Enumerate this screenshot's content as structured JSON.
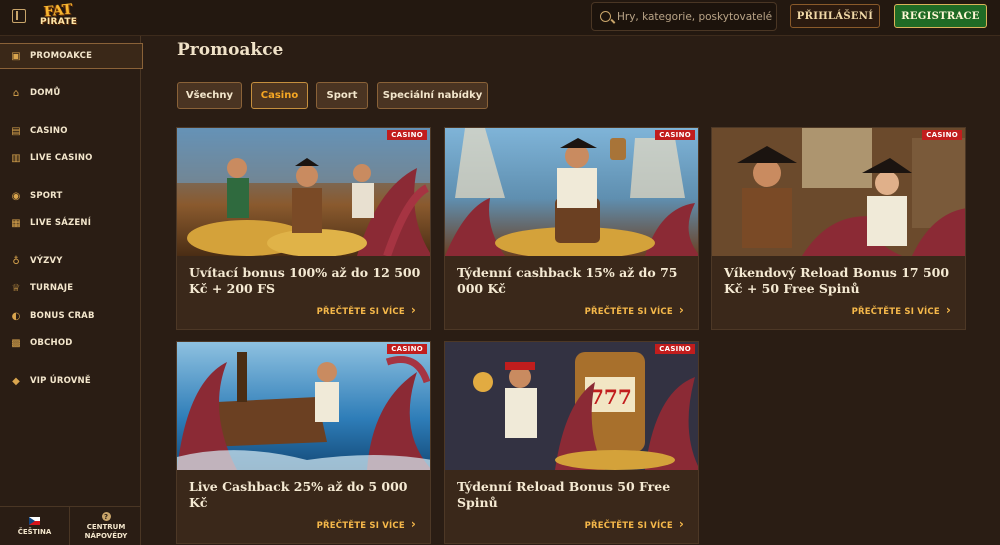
{
  "header": {
    "logo_top": "FAT",
    "logo_bottom": "PIRATE",
    "search_placeholder": "Hry, kategorie, poskytovatelé",
    "login_label": "PŘIHLÁŠENÍ",
    "register_label": "REGISTRACE"
  },
  "sidebar": {
    "items": [
      {
        "label": "PROMOAKCE",
        "icon": "gift-icon",
        "active": true
      },
      {
        "label": "DOMŮ",
        "icon": "home-icon"
      },
      {
        "label": "CASINO",
        "icon": "slot-machine-icon"
      },
      {
        "label": "LIVE CASINO",
        "icon": "cards-icon"
      },
      {
        "label": "SPORT",
        "icon": "soccer-ball-icon"
      },
      {
        "label": "LIVE SÁZENÍ",
        "icon": "live-icon"
      },
      {
        "label": "VÝZVY",
        "icon": "challenge-icon"
      },
      {
        "label": "TURNAJE",
        "icon": "trophy-icon"
      },
      {
        "label": "BONUS CRAB",
        "icon": "crab-icon"
      },
      {
        "label": "OBCHOD",
        "icon": "shop-icon"
      },
      {
        "label": "VIP ÚROVNĚ",
        "icon": "diamond-icon"
      }
    ],
    "language_label": "ČEŠTINA",
    "help_label_1": "CENTRUM",
    "help_label_2": "NÁPOVĚDY"
  },
  "main": {
    "title": "Promoakce",
    "filters": [
      {
        "label": "Všechny",
        "active": false
      },
      {
        "label": "Casino",
        "active": true
      },
      {
        "label": "Sport",
        "active": false
      },
      {
        "label": "Speciální nabídky",
        "active": false
      }
    ],
    "cards": [
      {
        "badge": "CASINO",
        "title": "Uvítací bonus 100% až do 12 500 Kč + 200 FS",
        "more": "PŘEČTĚTE SI VÍCE"
      },
      {
        "badge": "CASINO",
        "title": "Týdenní cashback 15% až do 75 000 Kč",
        "more": "PŘEČTĚTE SI VÍCE"
      },
      {
        "badge": "CASINO",
        "title": "Víkendový Reload Bonus 17 500 Kč + 50 Free Spinů",
        "more": "PŘEČTĚTE SI VÍCE"
      },
      {
        "badge": "CASINO",
        "title": "Live Cashback 25% až do 5 000 Kč",
        "more": "PŘEČTĚTE SI VÍCE"
      },
      {
        "badge": "CASINO",
        "title": "Týdenní Reload Bonus 50 Free Spinů",
        "more": "PŘEČTĚTE SI VÍCE"
      }
    ]
  },
  "colors": {
    "background": "#2a1d14",
    "accent": "#f5a623",
    "badge": "#c11d1d",
    "register": "#1f6b25"
  }
}
